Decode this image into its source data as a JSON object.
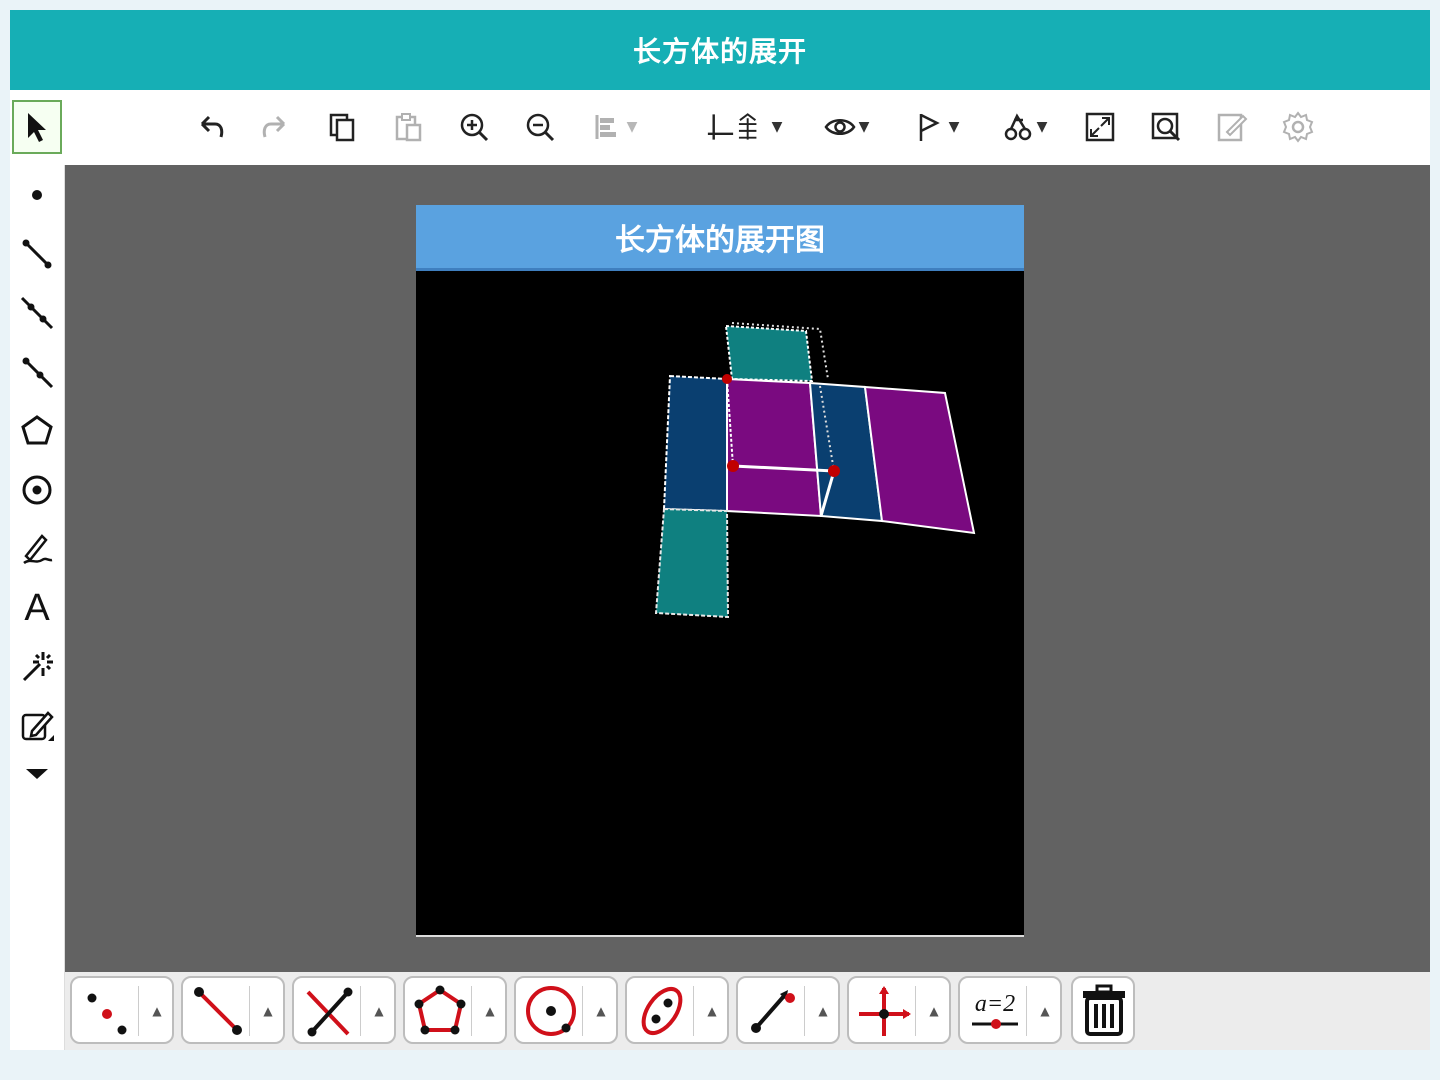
{
  "app": {
    "title": "长方体的展开"
  },
  "panel": {
    "title": "长方体的展开图"
  },
  "toolbar": {
    "items": [
      {
        "name": "undo",
        "icon": "undo-icon"
      },
      {
        "name": "redo",
        "icon": "redo-icon",
        "disabled": true
      },
      {
        "name": "copy",
        "icon": "copy-icon"
      },
      {
        "name": "paste",
        "icon": "paste-icon",
        "disabled": true
      },
      {
        "name": "zoom-in",
        "icon": "zoom-in-icon"
      },
      {
        "name": "zoom-out",
        "icon": "zoom-out-icon"
      },
      {
        "name": "align",
        "icon": "align-icon",
        "disabled": true
      },
      {
        "name": "coordinate-system",
        "icon": "axes-icon"
      },
      {
        "name": "visibility",
        "icon": "eye-icon"
      },
      {
        "name": "flag",
        "icon": "flag-icon"
      },
      {
        "name": "animation",
        "icon": "animation-icon"
      },
      {
        "name": "fullscreen",
        "icon": "fullscreen-icon"
      },
      {
        "name": "find",
        "icon": "search-icon"
      },
      {
        "name": "edit",
        "icon": "edit-icon",
        "disabled": true
      },
      {
        "name": "settings",
        "icon": "gear-icon",
        "disabled": true
      }
    ]
  },
  "sidebar": {
    "tools": [
      {
        "name": "select",
        "icon": "pointer-arrow-icon",
        "active": true
      },
      {
        "name": "point",
        "icon": "point-icon"
      },
      {
        "name": "segment",
        "icon": "segment-icon"
      },
      {
        "name": "line",
        "icon": "line-icon"
      },
      {
        "name": "ray",
        "icon": "ray-icon"
      },
      {
        "name": "polygon",
        "icon": "polygon-icon"
      },
      {
        "name": "circle",
        "icon": "circle-icon"
      },
      {
        "name": "pen",
        "icon": "pen-icon"
      },
      {
        "name": "text",
        "icon": "text-icon",
        "label": "A"
      },
      {
        "name": "effects",
        "icon": "sparkle-icon"
      },
      {
        "name": "edit",
        "icon": "edit-icon"
      },
      {
        "name": "more",
        "icon": "chevron-down-icon"
      }
    ]
  },
  "bottombar": {
    "tools": [
      {
        "name": "points",
        "icon": "points-icon"
      },
      {
        "name": "segment",
        "icon": "segment-tool-icon"
      },
      {
        "name": "intersection",
        "icon": "intersection-icon"
      },
      {
        "name": "polygon",
        "icon": "polygon-tool-icon"
      },
      {
        "name": "circle",
        "icon": "circle-tool-icon"
      },
      {
        "name": "ellipse",
        "icon": "ellipse-tool-icon"
      },
      {
        "name": "ray",
        "icon": "ray-tool-icon"
      },
      {
        "name": "axes",
        "icon": "axes-tool-icon"
      },
      {
        "name": "slider",
        "icon": "slider-icon",
        "label": "a=2"
      },
      {
        "name": "delete",
        "icon": "trash-icon"
      }
    ]
  },
  "colors": {
    "title_bar": "#16afb5",
    "panel_header": "#5aa2e0",
    "canvas": "#626262",
    "face_teal": "#0f8080",
    "face_blue": "#0a3f70",
    "face_purple": "#7a0a80",
    "vertex": "#c00000"
  }
}
